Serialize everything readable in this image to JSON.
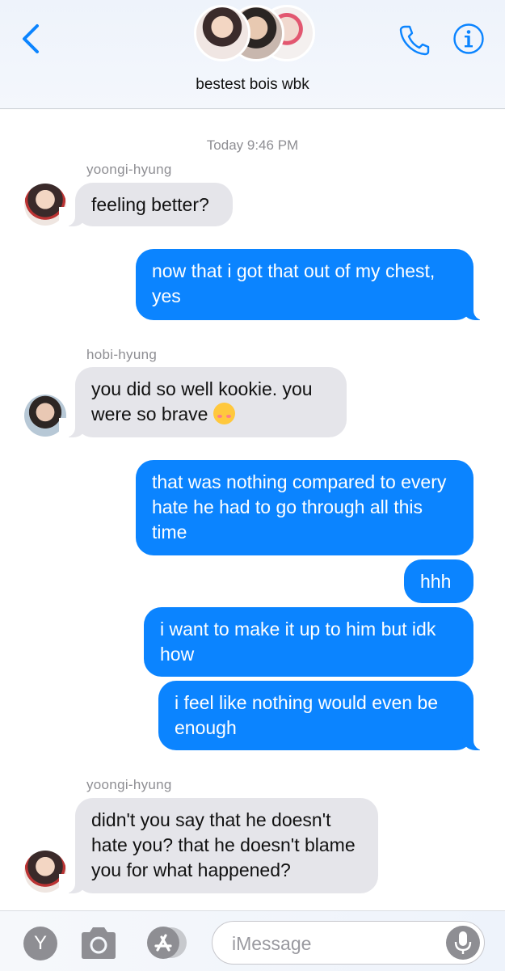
{
  "header": {
    "group_name": "bestest bois wbk"
  },
  "colors": {
    "outgoing": "#0b84ff",
    "incoming": "#e5e5ea",
    "accent": "#0b84ff"
  },
  "icons": {
    "back": "chevron-left-icon",
    "phone": "phone-icon",
    "info": "info-icon",
    "camera": "camera-icon",
    "apps": "app-store-icon",
    "mic": "microphone-icon"
  },
  "chat": {
    "timestamp": "Today 9:46 PM",
    "messages": [
      {
        "direction": "incoming",
        "sender": "yoongi-hyung",
        "text": "feeling better?"
      },
      {
        "direction": "outgoing",
        "text": "now that i got that out of my chest, yes"
      },
      {
        "direction": "incoming",
        "sender": "hobi-hyung",
        "text": "you did so well kookie. you were so brave",
        "emoji": "smiling-face-with-hearts"
      },
      {
        "direction": "outgoing",
        "text": "that was nothing compared to every hate he had to go through all this time"
      },
      {
        "direction": "outgoing",
        "text": "hhh"
      },
      {
        "direction": "outgoing",
        "text": "i want to make it up to him but idk how"
      },
      {
        "direction": "outgoing",
        "text": "i feel like nothing would even be enough"
      },
      {
        "direction": "incoming",
        "sender": "yoongi-hyung",
        "text": "didn't you say that he doesn't hate you? that he doesn't blame you for what happened?"
      }
    ]
  },
  "bottom_bar": {
    "y_button_label": "Y",
    "message_placeholder": "iMessage"
  }
}
